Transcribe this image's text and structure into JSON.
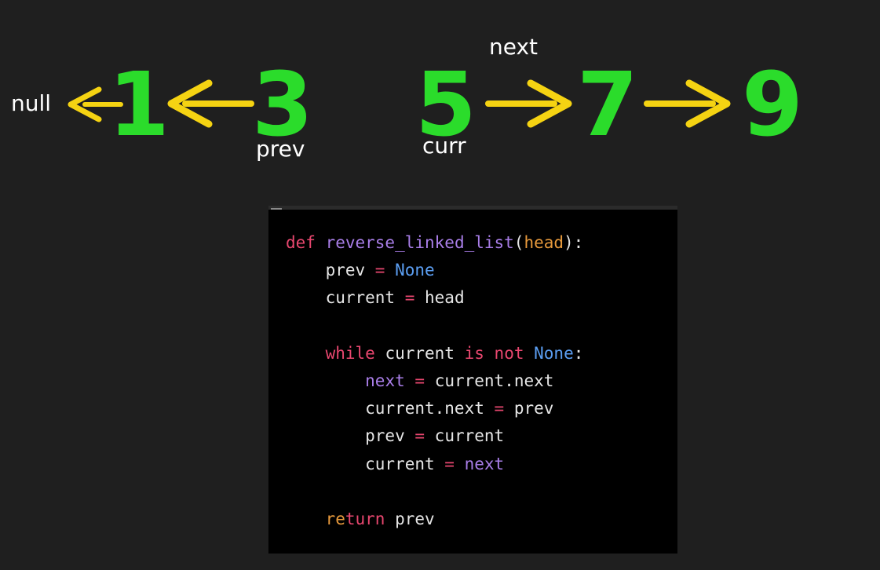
{
  "diagram": {
    "null_label": "null",
    "nodes": [
      "1",
      "3",
      "5",
      "7",
      "9"
    ],
    "pointer_labels": {
      "prev": "prev",
      "curr": "curr",
      "next": "next"
    },
    "colors": {
      "background": "#1f1f1f",
      "node": "#2bdc2b",
      "arrow": "#f5d312",
      "label": "#ffffff"
    }
  },
  "code": {
    "lines": [
      {
        "segments": [
          {
            "t": "def ",
            "c": "kw"
          },
          {
            "t": "reverse_linked_list",
            "c": "fn"
          },
          {
            "t": "(",
            "c": ""
          },
          {
            "t": "head",
            "c": "par"
          },
          {
            "t": "):",
            "c": ""
          }
        ]
      },
      {
        "segments": [
          {
            "t": "    prev ",
            "c": ""
          },
          {
            "t": "=",
            "c": "op"
          },
          {
            "t": " ",
            "c": ""
          },
          {
            "t": "None",
            "c": "bi"
          }
        ]
      },
      {
        "segments": [
          {
            "t": "    current ",
            "c": ""
          },
          {
            "t": "=",
            "c": "op"
          },
          {
            "t": " head",
            "c": ""
          }
        ]
      },
      {
        "segments": []
      },
      {
        "segments": [
          {
            "t": "    ",
            "c": ""
          },
          {
            "t": "while",
            "c": "kw"
          },
          {
            "t": " current ",
            "c": ""
          },
          {
            "t": "is",
            "c": "kw"
          },
          {
            "t": " ",
            "c": ""
          },
          {
            "t": "not",
            "c": "kw"
          },
          {
            "t": " ",
            "c": ""
          },
          {
            "t": "None",
            "c": "bi"
          },
          {
            "t": ":",
            "c": ""
          }
        ]
      },
      {
        "segments": [
          {
            "t": "        ",
            "c": ""
          },
          {
            "t": "next",
            "c": "var"
          },
          {
            "t": " ",
            "c": ""
          },
          {
            "t": "=",
            "c": "op"
          },
          {
            "t": " current.next",
            "c": ""
          }
        ]
      },
      {
        "segments": [
          {
            "t": "        current.next ",
            "c": ""
          },
          {
            "t": "=",
            "c": "op"
          },
          {
            "t": " prev",
            "c": ""
          }
        ]
      },
      {
        "segments": [
          {
            "t": "        prev ",
            "c": ""
          },
          {
            "t": "=",
            "c": "op"
          },
          {
            "t": " current",
            "c": ""
          }
        ]
      },
      {
        "segments": [
          {
            "t": "        current ",
            "c": ""
          },
          {
            "t": "=",
            "c": "op"
          },
          {
            "t": " ",
            "c": ""
          },
          {
            "t": "next",
            "c": "var"
          }
        ]
      },
      {
        "segments": []
      },
      {
        "segments": [
          {
            "t": "    ",
            "c": ""
          },
          {
            "t": "re",
            "c": "ret2"
          },
          {
            "t": "turn",
            "c": "ret"
          },
          {
            "t": " prev",
            "c": ""
          }
        ]
      }
    ]
  }
}
